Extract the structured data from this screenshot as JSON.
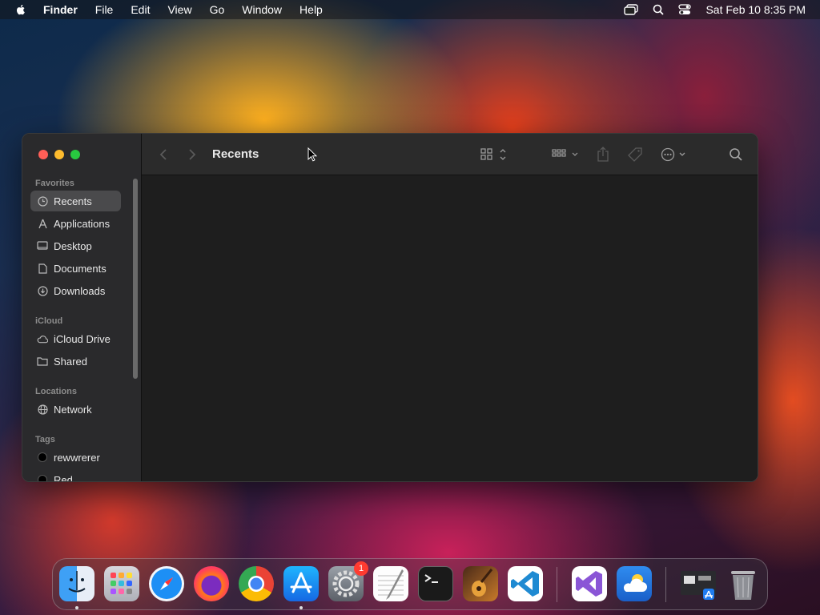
{
  "menubar": {
    "app": "Finder",
    "items": [
      "File",
      "Edit",
      "View",
      "Go",
      "Window",
      "Help"
    ],
    "clock": "Sat Feb 10  8:35 PM"
  },
  "window": {
    "title": "Recents",
    "sidebar": {
      "sections": {
        "favorites": "Favorites",
        "icloud": "iCloud",
        "locations": "Locations",
        "tags": "Tags"
      },
      "favorites": [
        "Recents",
        "Applications",
        "Desktop",
        "Documents",
        "Downloads"
      ],
      "icloud": [
        "iCloud Drive",
        "Shared"
      ],
      "locations": [
        "Network"
      ],
      "tags": [
        "rewwrerer",
        "Red"
      ]
    }
  },
  "dock": {
    "apps": [
      "finder-icon",
      "launchpad-icon",
      "safari-icon",
      "firefox-icon",
      "chrome-icon",
      "app-store-icon",
      "system-settings-icon",
      "textedit-icon",
      "terminal-icon",
      "garageband-icon",
      "vscode-icon",
      "visual-studio-icon",
      "weather-icon",
      "app-folder-icon",
      "trash-icon"
    ],
    "settings_badge": "1"
  },
  "colors": {
    "sidebar": "#2a2a2c",
    "content": "#1e1e1e",
    "selection": "#4a4a4c",
    "traffic_red": "#ff5f57",
    "traffic_yellow": "#febc2e",
    "traffic_green": "#28c840"
  }
}
